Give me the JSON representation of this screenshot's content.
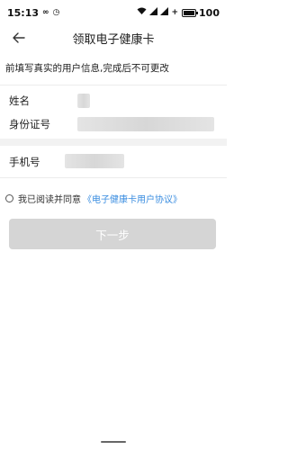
{
  "status_bar": {
    "time": "15:13",
    "left_icons": [
      "infinity-icon",
      "clock-icon"
    ],
    "right_icons": [
      "wifi-icon",
      "signal-icon",
      "signal-icon",
      "plus-icon"
    ],
    "battery": "100"
  },
  "nav": {
    "title": "领取电子健康卡"
  },
  "notice": "前填写真实的用户信息,完成后不可更改",
  "form": {
    "name_label": "姓名",
    "id_label": "身份证号",
    "phone_label": "手机号"
  },
  "agreement": {
    "prefix": "我已阅读并同意",
    "link": "《电子健康卡用户协议》"
  },
  "next_button": "下一步",
  "colors": {
    "link": "#3a8de0",
    "button_disabled": "#d5d5d5",
    "divider": "#f2f2f2"
  }
}
